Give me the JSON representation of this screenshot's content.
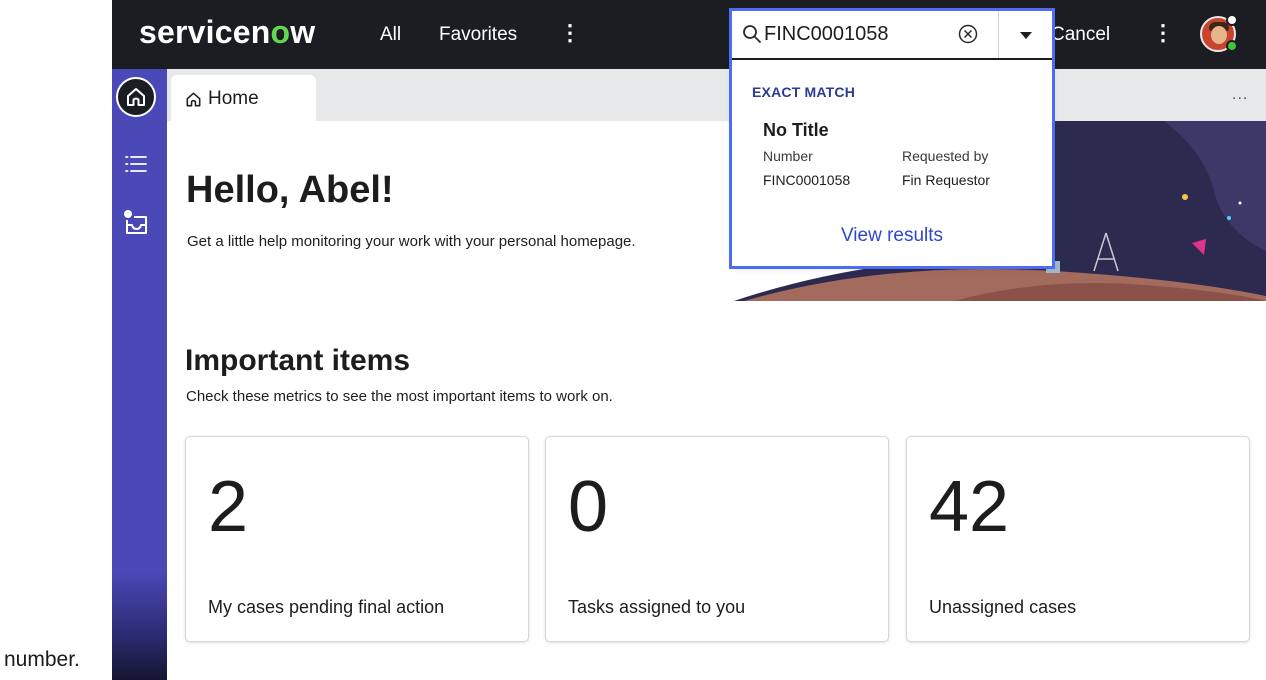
{
  "caption": "number.",
  "topbar": {
    "logo_pre": "servicen",
    "logo_o": "o",
    "logo_post": "w",
    "nav_all": "All",
    "nav_favorites": "Favorites",
    "nav_more": "⋮",
    "cancel": "Cancel",
    "more": "⋮"
  },
  "search": {
    "value": "FINC0001058",
    "dropdown": {
      "heading": "EXACT MATCH",
      "result_title": "No Title",
      "col1_header": "Number",
      "col1_value": "FINC0001058",
      "col2_header": "Requested by",
      "col2_value": "Fin Requestor",
      "view_results": "View results"
    }
  },
  "tabs": [
    {
      "label": "Home"
    }
  ],
  "tabstrip_more": "...",
  "hero": {
    "title": "Hello, Abel!",
    "subtitle": "Get a little help monitoring your work with your personal homepage."
  },
  "important": {
    "title": "Important items",
    "subtitle": "Check these metrics to see the most important items to work on.",
    "cards": [
      {
        "value": "2",
        "label": "My cases pending final action"
      },
      {
        "value": "0",
        "label": "Tasks assigned to you"
      },
      {
        "value": "42",
        "label": "Unassigned cases"
      }
    ]
  },
  "colors": {
    "topbar_bg": "#1b1d22",
    "rail_bg": "#4b49b8",
    "highlight_frame": "#4c6df0",
    "link": "#2f48c9",
    "logo_accent": "#62d84e"
  },
  "icons": [
    "search-icon",
    "clear-icon",
    "caret-down-icon",
    "home-icon",
    "list-icon",
    "inbox-icon",
    "avatar"
  ]
}
